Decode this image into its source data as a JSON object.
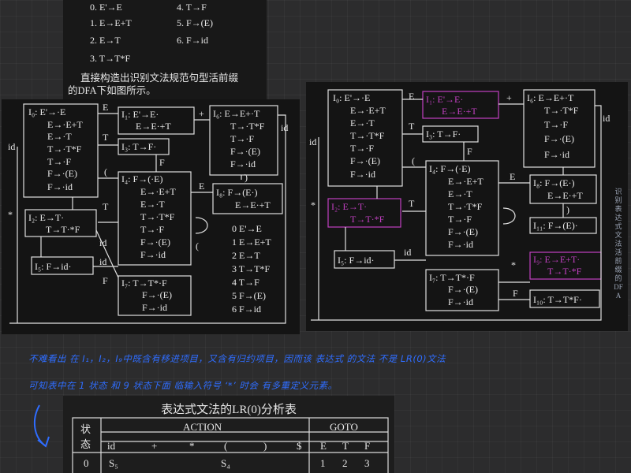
{
  "grammar": {
    "prods": [
      "0.  E'→E",
      "1.  E→E+T",
      "2.  E→T",
      "3.  T→T*F",
      "4.  T→F",
      "5.  F→(E)",
      "6.  F→id"
    ],
    "caption1": "直接构造出识别文法规范句型活前缀",
    "caption2": "的DFA下如图所示。"
  },
  "left": {
    "I0": [
      "I₀: E'→·E",
      "E→·E+T",
      "E→·T",
      "T→·T*F",
      "T→·F",
      "F→·(E)",
      "F→·id"
    ],
    "I1": [
      "I₁: E'→E·",
      "E→E·+T"
    ],
    "I3": "I₃: T→F·",
    "I4": [
      "I₄: F→(·E)",
      "E→·E+T",
      "E→·T",
      "T→·T*F",
      "T→·F",
      "F→·(E)",
      "F→·id"
    ],
    "I6": [
      "I₆: E→E+·T",
      "T→·T*F",
      "T→·F",
      "F→·(E)",
      "F→·id"
    ],
    "I8": [
      "I₈: F→(E·)",
      "E→E·+T"
    ],
    "I2": [
      "I₂:  E→T·",
      "T→T·*F"
    ],
    "I5": "I₅:  F→id·",
    "I7": [
      "I₇:  T→T*·F",
      "F→·(E)",
      "F→·id"
    ],
    "list": [
      "0    E'→E",
      "1    E→E+T",
      "2    E→T",
      "3    T→T*F",
      "4    T→F",
      "5    F→(E)",
      "6    F→id"
    ],
    "edges": {
      "E": "E",
      "plus": "+",
      "T": "T",
      "F": "F",
      "lp": "(",
      "id": "id",
      "star": "*",
      "rp": ")"
    }
  },
  "right": {
    "I0": [
      "I₀: E'→·E",
      "E→·E+T",
      "E→·T",
      "T→·T*F",
      "T→·F",
      "F→·(E)",
      "F→·id"
    ],
    "I1": [
      "I₁: E'→E·",
      "E→E·+T"
    ],
    "I3": "I₃: T→F·",
    "I4": [
      "I₄: F→(·E)",
      "E→·E+T",
      "E→·T",
      "T→·T*F",
      "T→·F",
      "F→·(E)",
      "F→·id"
    ],
    "I6": [
      "I₆: E→E+·T",
      "T→·T*F",
      "T→·F",
      "F→·(E)",
      "F→·id"
    ],
    "I8": [
      "I₈: F→(E·)",
      "E→E·+T"
    ],
    "I11": "I₁₁: F→(E)·",
    "I2": [
      "I₂:  E→T·",
      "T→T·*F"
    ],
    "I5": "I₅:  F→id·",
    "I7": [
      "I₇:  T→T*·F",
      "F→·(E)",
      "F→·id"
    ],
    "I9": [
      "I₉: E→E+T·",
      "T→T·*F"
    ],
    "I10": "I₁₀: T→T*F·",
    "vertical": "识别表达式文法活前缀的DFA",
    "highlight_color": "#c040c0"
  },
  "note": {
    "line1": "不难看出 在 I₁，I₂，I₉中既含有移进项目，又含有归约项目，因而该 表达式 的文法 不是 LR(0)文法",
    "line2": "可知表中在 1 状态 和 9 状态下面 临输入符号 ‘*’ 时会 有多重定义元素。"
  },
  "table": {
    "title": "表达式文法的LR(0)分析表",
    "state_header": "状\n态",
    "action": "ACTION",
    "goto": "GOTO",
    "cols": [
      "id",
      "+",
      "*",
      "(",
      ")",
      "$",
      "E",
      "T",
      "F"
    ],
    "row0": {
      "state": "0",
      "id": "S₅",
      "lp": "S₄",
      "E": "1",
      "T": "2",
      "F": "3"
    }
  }
}
